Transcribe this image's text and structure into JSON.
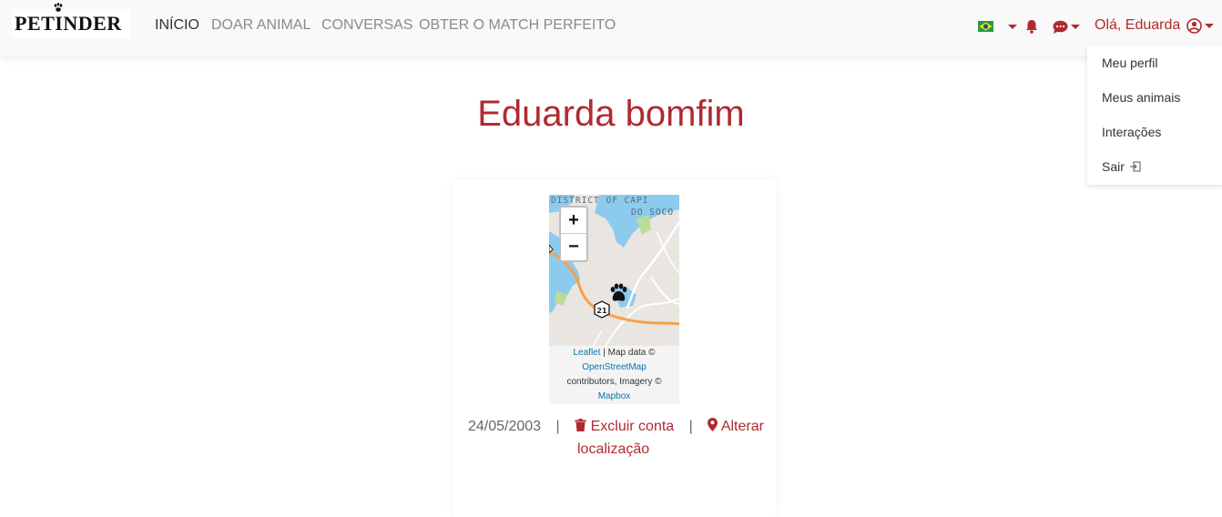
{
  "brand": {
    "name": "PETINDER"
  },
  "nav": {
    "items": [
      {
        "label": "INÍCIO",
        "active": true
      },
      {
        "label": "DOAR ANIMAL",
        "active": false
      },
      {
        "label": "CONVERSAS",
        "active": false
      },
      {
        "label": "OBTER O MATCH PERFEITO",
        "active": false
      }
    ],
    "language_flag": "brazil-flag-icon",
    "user_greeting": "Olá, Eduarda"
  },
  "user_menu": {
    "items": [
      {
        "label": "Meu perfil"
      },
      {
        "label": "Meus animais"
      },
      {
        "label": "Interações"
      },
      {
        "label": "Sair"
      }
    ]
  },
  "profile": {
    "name": "Eduarda bomfim",
    "birth_date": "24/05/2003",
    "separator": "|",
    "delete_label": "Excluir conta",
    "change_location_label_1": "Alterar",
    "change_location_label_2": "localização"
  },
  "map": {
    "zoom_in": "+",
    "zoom_out": "−",
    "label_top": "DISTRICT  OF CAPI",
    "label_top2": "DO SOCO",
    "road_shield": "21",
    "attribution": {
      "leaflet": "Leaflet",
      "map_data": " | Map data ©",
      "osm": "OpenStreetMap",
      "contrib": "contributors, Imagery ©",
      "mapbox": "Mapbox"
    }
  },
  "colors": {
    "brand_red": "#b02a30",
    "nav_bg": "#f9f9f9",
    "water": "#7fc8ef",
    "road": "#f5a14c"
  }
}
